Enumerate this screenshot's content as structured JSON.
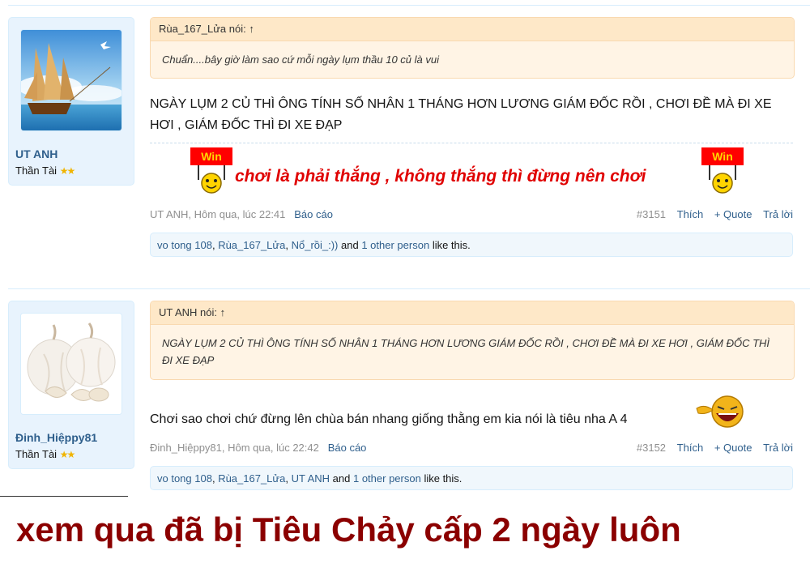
{
  "posts": [
    {
      "username": "UT ANH",
      "user_title": "Thần Tài",
      "stars": "★★",
      "quote_author": "Rùa_167_Lửa nói: ↑",
      "quote_text": "Chuẩn....bây giờ làm sao cứ mỗi ngày lụm thầu 10 củ là vui",
      "message": "NGÀY LỤM 2 CỦ THÌ ÔNG TÍNH SỐ NHÂN 1 THÁNG HƠN LƯƠNG GIÁM ĐỐC RỒI , CHƠI ĐỀ MÀ ĐI XE HƠI , GIÁM ĐỐC THÌ ĐI XE ĐẠP",
      "signature": "chơi là phải thắng , không thắng thì đừng nên chơi",
      "signature_badge": "Win",
      "meta_author_time": "UT ANH, Hôm qua, lúc 22:41",
      "report": "Báo cáo",
      "post_number": "#3151",
      "like": "Thích",
      "quote_btn": "+ Quote",
      "reply": "Trả lời",
      "likes_users": [
        "vo tong 108",
        "Rùa_167_Lửa",
        "Nổ_rồi_:))"
      ],
      "likes_and": "and",
      "likes_other": "1 other person",
      "likes_suffix": "like this."
    },
    {
      "username": "Đinh_Hiệppy81",
      "user_title": "Thần Tài",
      "stars": "★★",
      "quote_author": "UT ANH nói: ↑",
      "quote_text": "NGÀY LỤM 2 CỦ THÌ ÔNG TÍNH SỐ NHÂN 1 THÁNG HƠN LƯƠNG GIÁM ĐỐC RỒI , CHƠI ĐỀ MÀ ĐI XE HƠI , GIÁM ĐỐC THÌ ĐI XE ĐẠP",
      "message": "Chơi sao chơi chứ đừng lên chùa bán nhang giống thằng em kia nói là tiêu nha A 4",
      "meta_author_time": "Đinh_Hiệppy81, Hôm qua, lúc 22:42",
      "report": "Báo cáo",
      "post_number": "#3152",
      "like": "Thích",
      "quote_btn": "+ Quote",
      "reply": "Trả lời",
      "likes_users": [
        "vo tong 108",
        "Rùa_167_Lửa",
        "UT ANH"
      ],
      "likes_and": "and",
      "likes_other": "1 other person",
      "likes_suffix": "like this."
    }
  ],
  "caption": "xem qua đã bị Tiêu Chảy cấp 2 ngày luôn",
  "colors": {
    "caption": "#8b0000",
    "signature": "#e00000",
    "link": "#2f5f8c",
    "quote_bg": "#fff4e5",
    "user_panel": "#e8f3fd"
  }
}
